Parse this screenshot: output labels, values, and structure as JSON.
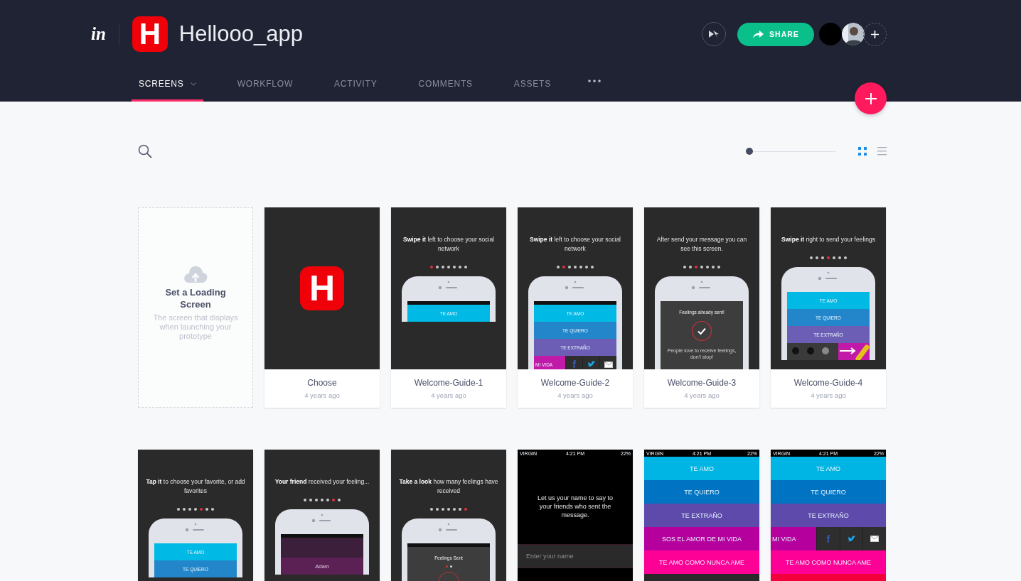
{
  "header": {
    "brand_logo": "in",
    "app": {
      "icon_letter": "H",
      "title": "Hellooo_app"
    },
    "share_button": {
      "label": "SHARE"
    },
    "collaborators": [
      {
        "kind": "blank"
      },
      {
        "kind": "photo"
      }
    ],
    "tabs": [
      {
        "label": "SCREENS",
        "selected": true,
        "dropdown": true
      },
      {
        "label": "WORKFLOW",
        "selected": false,
        "dropdown": false
      },
      {
        "label": "ACTIVITY",
        "selected": false,
        "dropdown": false
      },
      {
        "label": "COMMENTS",
        "selected": false,
        "dropdown": false
      },
      {
        "label": "ASSETS",
        "selected": false,
        "dropdown": false
      }
    ]
  },
  "toolbar": {
    "zoom_slider": {
      "level": 0
    },
    "views": [
      {
        "kind": "grid",
        "selected": true
      },
      {
        "kind": "list",
        "selected": false
      }
    ]
  },
  "cards": [
    {
      "kind": "placeholder",
      "title": "Set a Loading Screen",
      "text": "The screen that displays when launching your prototype"
    },
    {
      "kind": "screen",
      "name": "Choose",
      "time": "4 years ago",
      "thumb": {
        "kind": "logo",
        "letter": "H"
      }
    },
    {
      "kind": "screen",
      "name": "Welcome-Guide-1",
      "time": "4 years ago",
      "thumb": {
        "kind": "guide",
        "caption": "**Swipe it** left to choose your social network",
        "dots": [
          {
            "selected": true
          },
          {
            "selected": false
          },
          {
            "selected": false
          },
          {
            "selected": false
          },
          {
            "selected": false
          },
          {
            "selected": false
          },
          {
            "selected": false
          }
        ],
        "phone": {
          "status": true,
          "kind": "stripes",
          "rows": [
            {
              "kind": "band",
              "label": "TE AMO",
              "color": "#00b9e4"
            }
          ]
        }
      }
    },
    {
      "kind": "screen",
      "name": "Welcome-Guide-2",
      "time": "4 years ago",
      "thumb": {
        "kind": "guide",
        "caption": "**Swipe it** left to choose your social network",
        "dots": [
          {
            "selected": false
          },
          {
            "selected": true
          },
          {
            "selected": false
          },
          {
            "selected": false
          },
          {
            "selected": false
          },
          {
            "selected": false
          },
          {
            "selected": false
          }
        ],
        "phone": {
          "status": true,
          "kind": "stripes",
          "rows": [
            {
              "kind": "band",
              "label": "TE AMO",
              "color": "#00b9e4"
            },
            {
              "kind": "band",
              "label": "TE QUIERO",
              "color": "#2386ca"
            },
            {
              "kind": "band",
              "label": "TE EXTRAÑO",
              "color": "#6c5db5"
            },
            {
              "kind": "share",
              "label": "MI VIDA",
              "color": "#c21aa8",
              "options": [
                {
                  "kind": "letter",
                  "glyph": "f"
                },
                {
                  "kind": "bird"
                },
                {
                  "kind": "mail"
                }
              ]
            }
          ]
        }
      }
    },
    {
      "kind": "screen",
      "name": "Welcome-Guide-3",
      "time": "4 years ago",
      "thumb": {
        "kind": "guide",
        "caption": "After send your message you can see this screen.",
        "dots": [
          {
            "selected": false
          },
          {
            "selected": false
          },
          {
            "selected": true
          },
          {
            "selected": false
          },
          {
            "selected": false
          },
          {
            "selected": false
          },
          {
            "selected": false
          }
        ],
        "phone": {
          "status": false,
          "kind": "sent",
          "title": "Feelings already sent!",
          "text": "People love to receive feelings, don't stop!"
        }
      }
    },
    {
      "kind": "screen",
      "name": "Welcome-Guide-4",
      "time": "4 years ago",
      "thumb": {
        "kind": "guide",
        "caption": "**Swipe it** right to send your feelings",
        "dots": [
          {
            "selected": false
          },
          {
            "selected": false
          },
          {
            "selected": false
          },
          {
            "selected": true
          },
          {
            "selected": false
          },
          {
            "selected": false
          },
          {
            "selected": false
          }
        ],
        "phone": {
          "status": false,
          "kind": "stripes",
          "rows": [
            {
              "kind": "band",
              "label": "TE AMO",
              "color": "#00b9e4"
            },
            {
              "kind": "band",
              "label": "TE QUIERO",
              "color": "#2386ca"
            },
            {
              "kind": "band",
              "label": "TE EXTRAÑO",
              "color": "#6c5db5"
            },
            {
              "kind": "actions",
              "color": "#3a3a3a"
            }
          ]
        }
      }
    },
    {
      "kind": "screen",
      "thumb": {
        "kind": "guide",
        "caption": "**Tap it** to choose your favorite, or add favorites",
        "dots": [
          {
            "selected": false
          },
          {
            "selected": false
          },
          {
            "selected": false
          },
          {
            "selected": false
          },
          {
            "selected": true
          },
          {
            "selected": false
          },
          {
            "selected": false
          }
        ],
        "phone": {
          "status": false,
          "kind": "stripes",
          "rows": [
            {
              "kind": "band",
              "label": "TE AMO",
              "color": "#00b9e4"
            },
            {
              "kind": "band",
              "label": "TE QUIERO",
              "color": "#2386ca"
            }
          ]
        }
      }
    },
    {
      "kind": "screen",
      "thumb": {
        "kind": "guide",
        "caption": "**Your friend** received your feeling...",
        "dots": [
          {
            "selected": false
          },
          {
            "selected": false
          },
          {
            "selected": false
          },
          {
            "selected": false
          },
          {
            "selected": false
          },
          {
            "selected": true
          },
          {
            "selected": false
          }
        ],
        "phone": {
          "status": true,
          "kind": "names",
          "names": [
            "Adam"
          ]
        }
      }
    },
    {
      "kind": "screen",
      "thumb": {
        "kind": "guide",
        "caption": "**Take a look** how many feelings have received",
        "dots": [
          {
            "selected": false
          },
          {
            "selected": false
          },
          {
            "selected": false
          },
          {
            "selected": false
          },
          {
            "selected": false
          },
          {
            "selected": false
          },
          {
            "selected": true
          }
        ],
        "phone": {
          "status": true,
          "kind": "counter",
          "title": "Feelings Sent",
          "pages": [
            {
              "selected": true
            },
            {
              "selected": false
            }
          ]
        }
      }
    },
    {
      "kind": "screen",
      "thumb": {
        "kind": "fullscreen",
        "status_bar": {
          "carrier": "VIRGIN",
          "time": "4:21 PM",
          "battery": "22%"
        },
        "content": {
          "kind": "name_entry",
          "prompt": "Let us your name to say to your friends who sent the message.",
          "placeholder": "Enter your name"
        }
      }
    },
    {
      "kind": "screen",
      "thumb": {
        "kind": "fullscreen",
        "status_bar": {
          "carrier": "VIRGIN",
          "time": "4:21 PM",
          "battery": "22%"
        },
        "content": {
          "kind": "stripes",
          "rows": [
            {
              "kind": "band",
              "label": "TE AMO",
              "color": "#00b4e3"
            },
            {
              "kind": "band",
              "label": "TE QUIERO",
              "color": "#0073c2"
            },
            {
              "kind": "band",
              "label": "TE EXTRAÑO",
              "color": "#5e4aab"
            },
            {
              "kind": "band",
              "label": "SOS EL AMOR DE MI VIDA",
              "color": "#b5009e"
            },
            {
              "kind": "band",
              "label": "TE AMO COMO NUNCA AME",
              "color": "#fd0095"
            },
            {
              "kind": "band",
              "color": "#2a2a2a"
            }
          ]
        }
      }
    },
    {
      "kind": "screen",
      "thumb": {
        "kind": "fullscreen",
        "status_bar": {
          "carrier": "VIRGIN",
          "time": "4:21 PM",
          "battery": "22%"
        },
        "content": {
          "kind": "stripes",
          "rows": [
            {
              "kind": "band",
              "label": "TE AMO",
              "color": "#00b4e3"
            },
            {
              "kind": "band",
              "label": "TE QUIERO",
              "color": "#0073c2"
            },
            {
              "kind": "band",
              "label": "TE EXTRAÑO",
              "color": "#5e4aab"
            },
            {
              "kind": "share",
              "label": "MI VIDA",
              "color": "#b5009e",
              "options": [
                {
                  "kind": "letter",
                  "glyph": "f"
                },
                {
                  "kind": "bird"
                },
                {
                  "kind": "mail"
                }
              ]
            },
            {
              "kind": "band",
              "label": "TE AMO COMO NUNCA AME",
              "color": "#fd0095"
            },
            {
              "kind": "band",
              "color": "#f2003c"
            }
          ]
        }
      }
    }
  ]
}
